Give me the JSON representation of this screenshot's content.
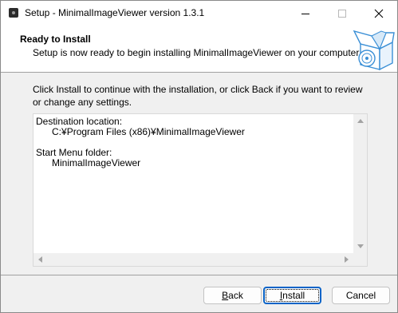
{
  "window": {
    "title": "Setup - MinimalImageViewer version 1.3.1"
  },
  "header": {
    "title": "Ready to Install",
    "subtitle": "Setup is now ready to begin installing MinimalImageViewer on your computer."
  },
  "body": {
    "instructions": "Click Install to continue with the installation, or click Back if you want to review or change any settings.",
    "memo": {
      "destination_label": "Destination location:",
      "destination_value": "C:¥Program Files (x86)¥MinimalImageViewer",
      "start_menu_label": "Start Menu folder:",
      "start_menu_value": "MinimalImageViewer"
    }
  },
  "buttons": {
    "back_accel": "B",
    "back_rest": "ack",
    "install_accel": "I",
    "install_rest": "nstall",
    "cancel": "Cancel"
  },
  "icons": {
    "app": "app-icon",
    "minimize": "minimize-icon",
    "maximize": "maximize-icon",
    "close": "close-icon",
    "wizard": "software-box-icon"
  },
  "colors": {
    "accent": "#0a64c8",
    "window_bg": "#f0f0f0",
    "header_bg": "#ffffff"
  }
}
